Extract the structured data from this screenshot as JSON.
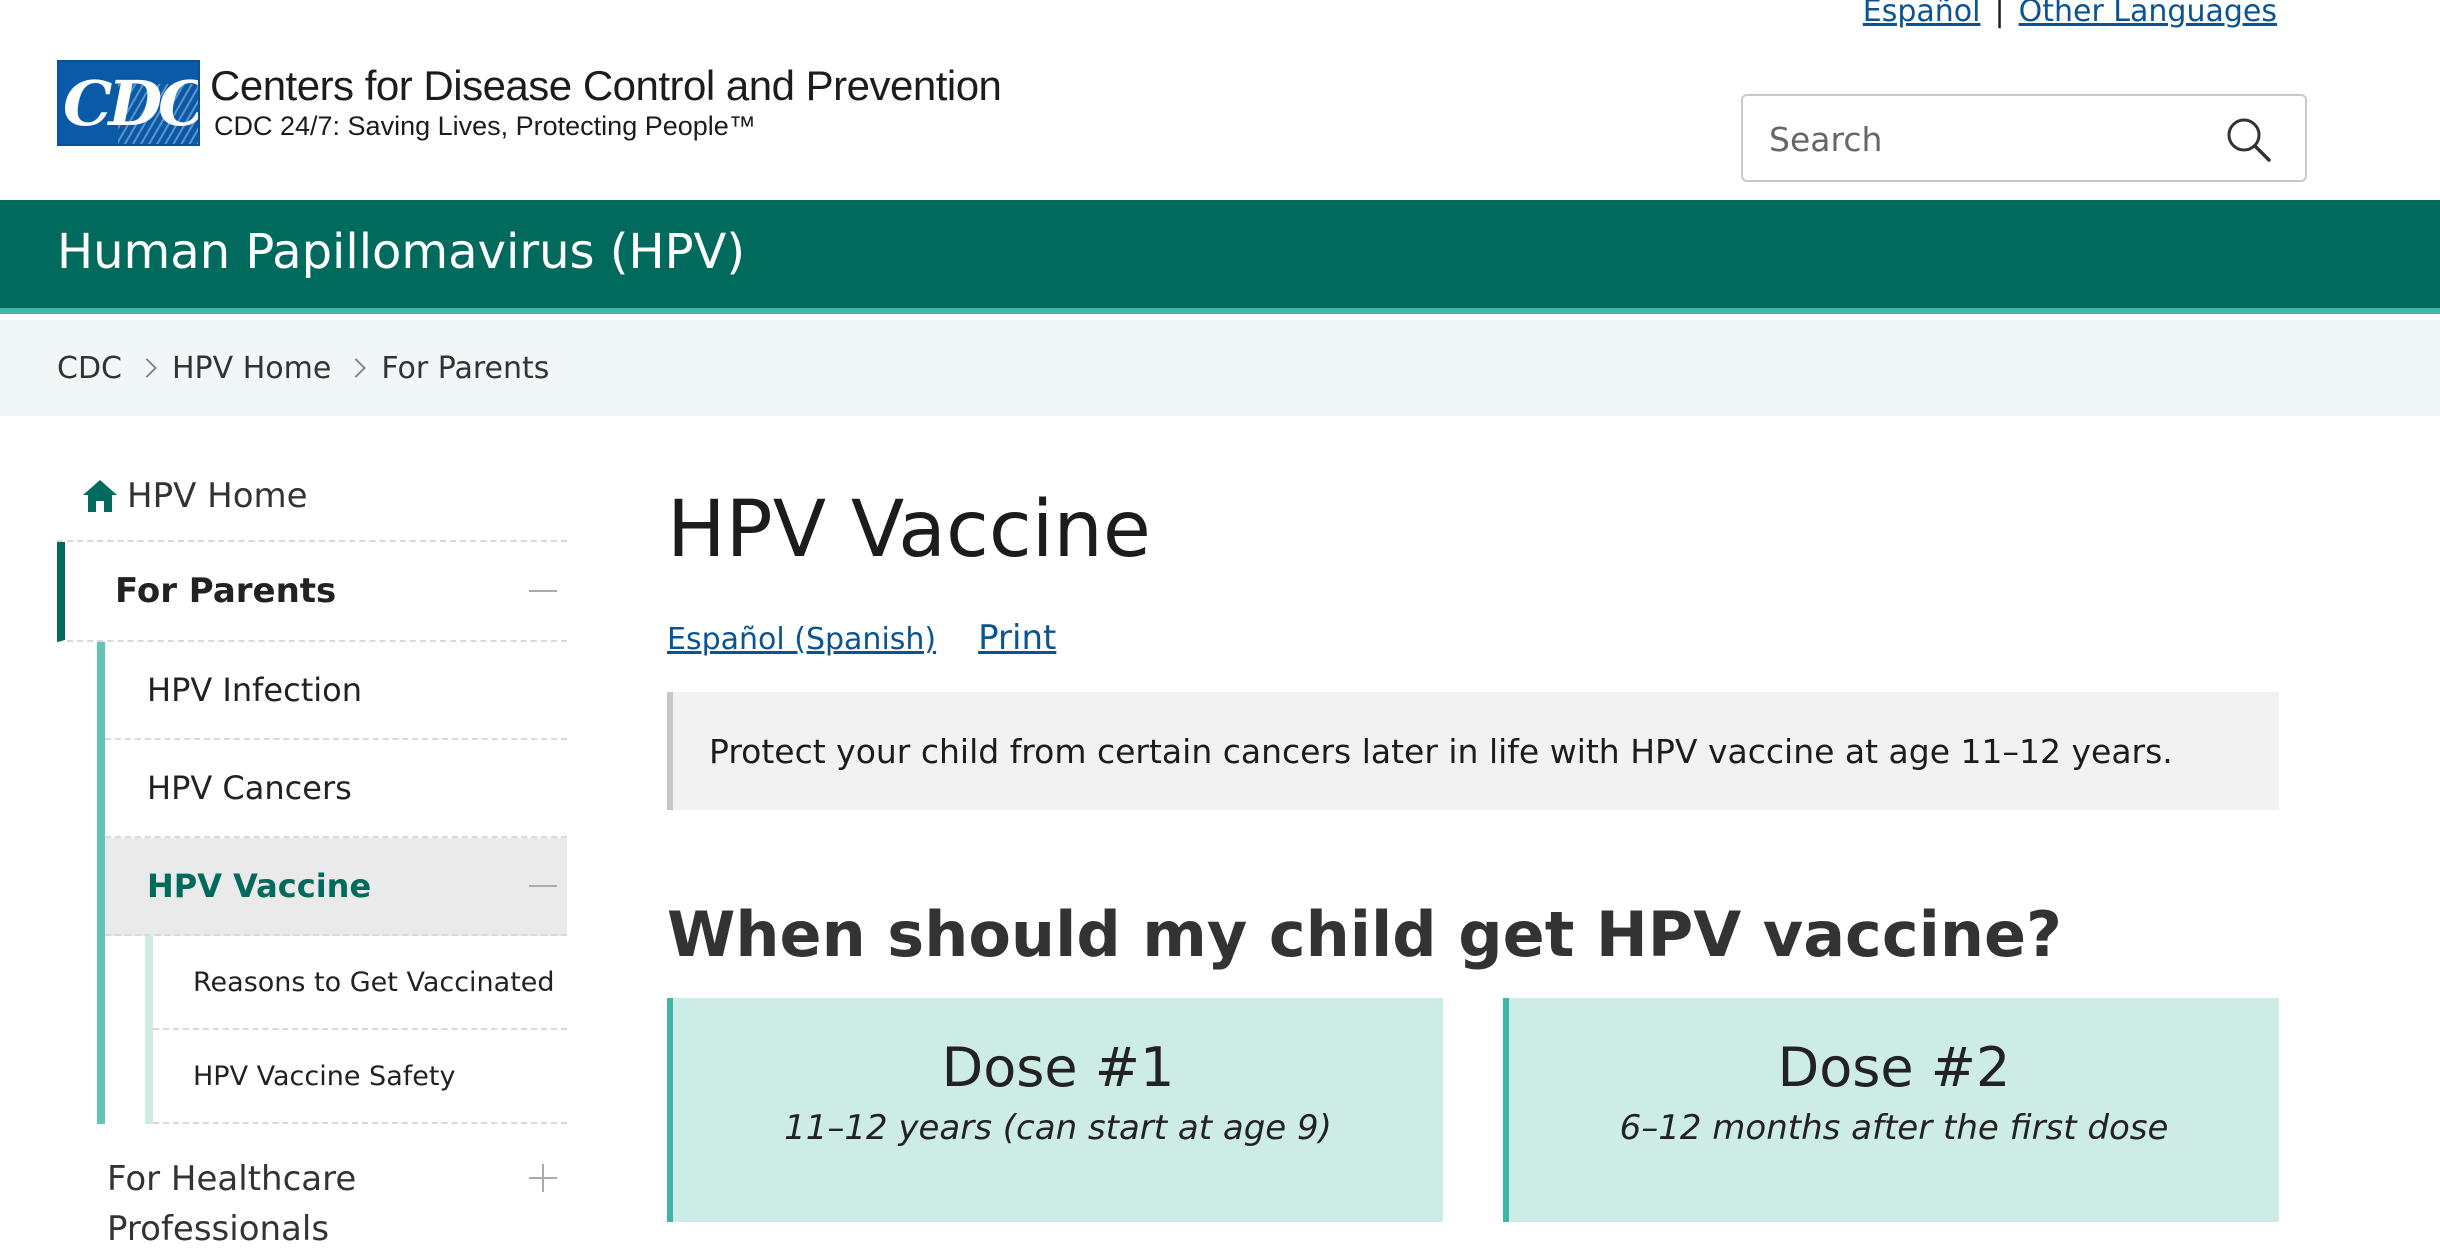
{
  "top_links": {
    "espanol": "Español",
    "separator": "|",
    "other_languages": "Other Languages"
  },
  "logo": {
    "mark": "CDC",
    "title": "Centers for Disease Control and Prevention",
    "tagline": "CDC 24/7: Saving Lives, Protecting People™"
  },
  "search": {
    "placeholder": "Search",
    "icon": "search-icon"
  },
  "site_title": "Human Papillomavirus (HPV)",
  "breadcrumb": [
    "CDC",
    "HPV Home",
    "For Parents"
  ],
  "sidebar": {
    "home": "HPV Home",
    "section": "For Parents",
    "items": [
      {
        "label": "HPV Infection"
      },
      {
        "label": "HPV Cancers"
      },
      {
        "label": "HPV Vaccine",
        "active": true
      }
    ],
    "subitems": [
      {
        "label": "Reasons to Get Vaccinated"
      },
      {
        "label": "HPV Vaccine Safety"
      }
    ],
    "hcp": "For Healthcare Professionals"
  },
  "main": {
    "title": "HPV Vaccine",
    "spanish_link": "Español (Spanish)",
    "print_link": "Print",
    "callout": "Protect your child from certain cancers later in life with HPV vaccine at age 11–12 years.",
    "section_heading": "When should my child get HPV vaccine?",
    "doses": [
      {
        "title": "Dose #1",
        "detail": "11–12 years (can start at age 9)"
      },
      {
        "title": "Dose #2",
        "detail": "6–12 months after the first dose"
      }
    ]
  },
  "colors": {
    "brand_green": "#006b5d",
    "accent_teal": "#3fb6a8",
    "link_blue": "#0b5493",
    "cdc_blue": "#0b5aa8"
  }
}
